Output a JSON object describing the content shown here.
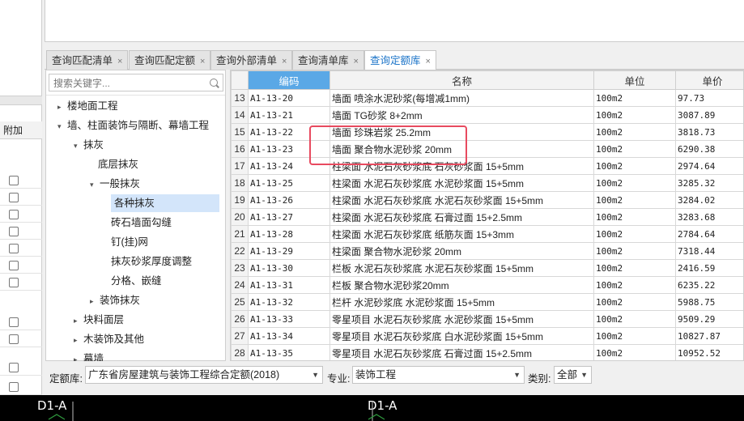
{
  "left_panel": {
    "column_header": "附加"
  },
  "tabs": [
    {
      "label": "查询匹配清单",
      "active": false
    },
    {
      "label": "查询匹配定额",
      "active": false
    },
    {
      "label": "查询外部清单",
      "active": false
    },
    {
      "label": "查询清单库",
      "active": false
    },
    {
      "label": "查询定额库",
      "active": true
    }
  ],
  "tab_close_glyph": "×",
  "search": {
    "placeholder": "搜索关键字..."
  },
  "tree": [
    {
      "label": "楼地面工程",
      "level": 0,
      "arrow": "▸"
    },
    {
      "label": "墙、柱面装饰与隔断、幕墙工程",
      "level": 0,
      "arrow": "▾"
    },
    {
      "label": "抹灰",
      "level": 1,
      "arrow": "▾"
    },
    {
      "label": "底层抹灰",
      "level": 2,
      "arrow": ""
    },
    {
      "label": "一般抹灰",
      "level": 2,
      "arrow": "▾"
    },
    {
      "label": "各种抹灰",
      "level": 3,
      "arrow": "",
      "selected": true
    },
    {
      "label": "砖石墙面勾缝",
      "level": 3,
      "arrow": ""
    },
    {
      "label": "钉(挂)网",
      "level": 3,
      "arrow": ""
    },
    {
      "label": "抹灰砂浆厚度调整",
      "level": 3,
      "arrow": ""
    },
    {
      "label": "分格、嵌缝",
      "level": 3,
      "arrow": ""
    },
    {
      "label": "装饰抹灰",
      "level": 2,
      "arrow": "▸"
    },
    {
      "label": "块料面层",
      "level": 1,
      "arrow": "▸"
    },
    {
      "label": "木装饰及其他",
      "level": 1,
      "arrow": "▸"
    },
    {
      "label": "幕墙",
      "level": 1,
      "arrow": "▸"
    }
  ],
  "table": {
    "headers": {
      "code": "编码",
      "name": "名称",
      "unit": "单位",
      "price": "单价"
    },
    "rows": [
      {
        "no": "13",
        "code": "A1-13-20",
        "name": "墙面 喷涂水泥砂浆(每增减1mm)",
        "unit": "100m2",
        "price": "97.73"
      },
      {
        "no": "14",
        "code": "A1-13-21",
        "name": "墙面 TG砂浆 8+2mm",
        "unit": "100m2",
        "price": "3087.89"
      },
      {
        "no": "15",
        "code": "A1-13-22",
        "name": "墙面 珍珠岩浆 25.2mm",
        "unit": "100m2",
        "price": "3818.73"
      },
      {
        "no": "16",
        "code": "A1-13-23",
        "name": "墙面 聚合物水泥砂浆 20mm",
        "unit": "100m2",
        "price": "6290.38"
      },
      {
        "no": "17",
        "code": "A1-13-24",
        "name": "柱梁面 水泥石灰砂浆底 石灰砂浆面 15+5mm",
        "unit": "100m2",
        "price": "2974.64"
      },
      {
        "no": "18",
        "code": "A1-13-25",
        "name": "柱梁面 水泥石灰砂浆底 水泥砂浆面 15+5mm",
        "unit": "100m2",
        "price": "3285.32"
      },
      {
        "no": "19",
        "code": "A1-13-26",
        "name": "柱梁面 水泥石灰砂浆底 水泥石灰砂浆面 15+5mm",
        "unit": "100m2",
        "price": "3284.02"
      },
      {
        "no": "20",
        "code": "A1-13-27",
        "name": "柱梁面 水泥石灰砂浆底 石膏过面 15+2.5mm",
        "unit": "100m2",
        "price": "3283.68"
      },
      {
        "no": "21",
        "code": "A1-13-28",
        "name": "柱梁面 水泥石灰砂浆底 纸筋灰面 15+3mm",
        "unit": "100m2",
        "price": "2784.64"
      },
      {
        "no": "22",
        "code": "A1-13-29",
        "name": "柱梁面 聚合物水泥砂浆 20mm",
        "unit": "100m2",
        "price": "7318.44"
      },
      {
        "no": "23",
        "code": "A1-13-30",
        "name": "栏板 水泥石灰砂浆底 水泥石灰砂浆面 15+5mm",
        "unit": "100m2",
        "price": "2416.59"
      },
      {
        "no": "24",
        "code": "A1-13-31",
        "name": "栏板 聚合物水泥砂浆20mm",
        "unit": "100m2",
        "price": "6235.22"
      },
      {
        "no": "25",
        "code": "A1-13-32",
        "name": "栏杆 水泥砂浆底 水泥砂浆面 15+5mm",
        "unit": "100m2",
        "price": "5988.75"
      },
      {
        "no": "26",
        "code": "A1-13-33",
        "name": "零星项目 水泥石灰砂浆底 水泥砂浆面 15+5mm",
        "unit": "100m2",
        "price": "9509.29"
      },
      {
        "no": "27",
        "code": "A1-13-34",
        "name": "零星项目 水泥石灰砂浆底 白水泥砂浆面 15+5mm",
        "unit": "100m2",
        "price": "10827.87"
      },
      {
        "no": "28",
        "code": "A1-13-35",
        "name": "零星项目 水泥石灰砂浆底 石膏过面 15+2.5mm",
        "unit": "100m2",
        "price": "10952.52"
      }
    ]
  },
  "filters": {
    "library_label": "定额库:",
    "library_value": "广东省房屋建筑与装饰工程综合定额(2018)",
    "specialty_label": "专业:",
    "specialty_value": "装饰工程",
    "category_label": "类别:",
    "category_value": "全部"
  },
  "cad": {
    "label_left": "D1-A",
    "label_right": "D1-A"
  },
  "colors": {
    "header_highlight": "#5aa8e6",
    "selected_node": "#d3e5fa",
    "annotation_box": "#e84a5f",
    "active_tab_text": "#1a73c8"
  }
}
